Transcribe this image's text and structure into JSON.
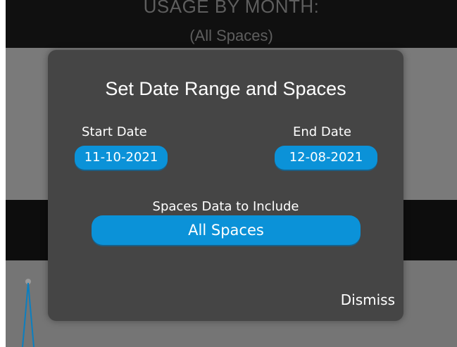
{
  "background": {
    "header_title": "USAGE BY MONTH:",
    "header_subtitle": "(All Spaces)",
    "chart_line_color": "#0b7fc0"
  },
  "modal": {
    "title": "Set Date Range and Spaces",
    "start_date_label": "Start Date",
    "start_date_value": "11-10-2021",
    "end_date_label": "End Date",
    "end_date_value": "12-08-2021",
    "spaces_label": "Spaces Data to Include",
    "spaces_value": "All Spaces",
    "dismiss_label": "Dismiss",
    "accent_color": "#0b92d8"
  }
}
